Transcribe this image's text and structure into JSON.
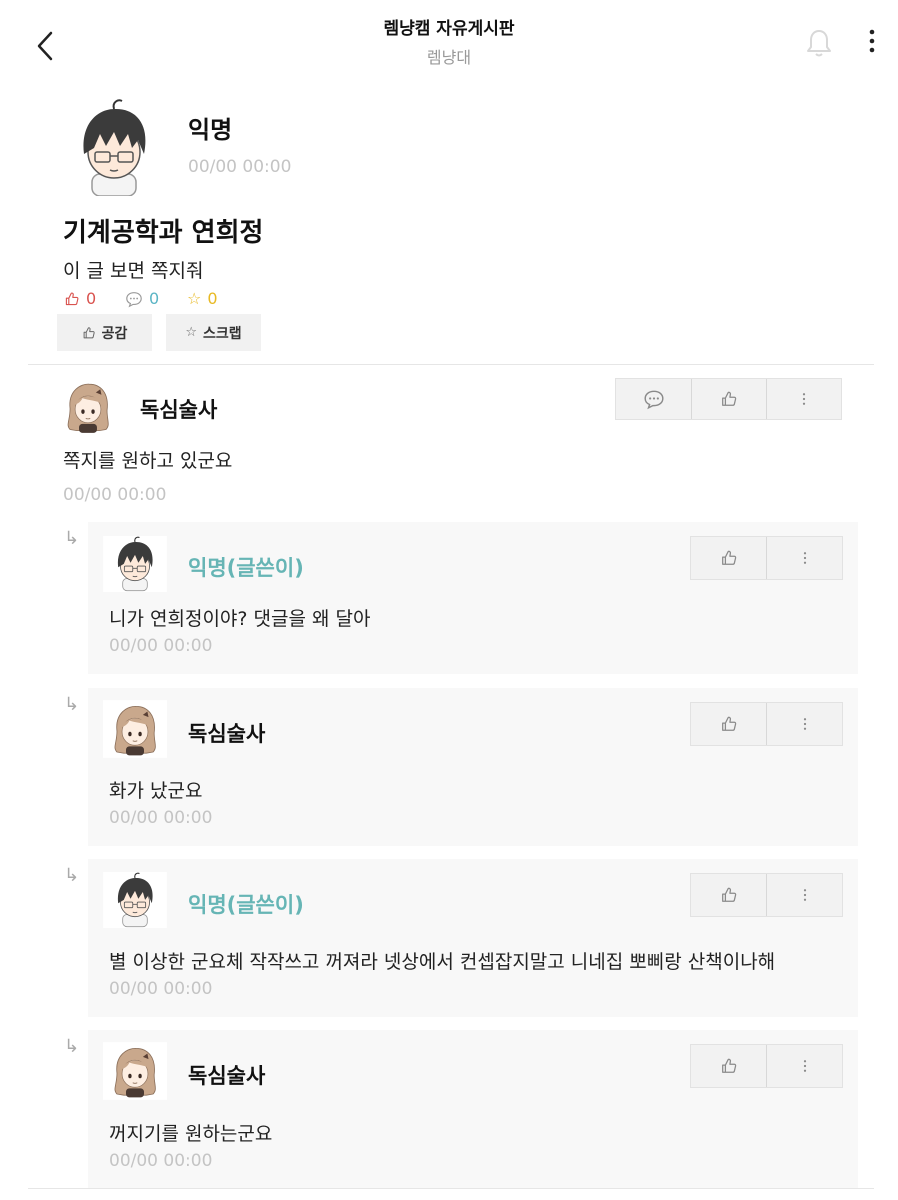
{
  "header": {
    "title": "렘냥캠 자유게시판",
    "subtitle": "렘냥대"
  },
  "post": {
    "author": "익명",
    "time": "00/00 00:00",
    "title": "기계공학과 연희정",
    "body": "이 글 보면 쪽지줘",
    "likes": "0",
    "comments": "0",
    "scraps": "0",
    "like_button": "공감",
    "scrap_button": "스크랩"
  },
  "comment": {
    "author": "독심술사",
    "body": "쪽지를 원하고 있군요",
    "time": "00/00 00:00"
  },
  "replies": [
    {
      "author": "익명(글쓴이)",
      "body": "니가 연희정이야? 댓글을 왜 달아",
      "time": "00/00 00:00"
    },
    {
      "author": "독심술사",
      "body": "화가 났군요",
      "time": "00/00 00:00"
    },
    {
      "author": "익명(글쓴이)",
      "body": "별 이상한 군요체 작작쓰고 꺼져라 넷상에서 컨셉잡지말고 니네집 뽀삐랑 산책이나해",
      "time": "00/00 00:00"
    },
    {
      "author": "독심술사",
      "body": "꺼지기를 원하는군요",
      "time": "00/00 00:00"
    }
  ],
  "colors": {
    "like_red": "#d9534f",
    "comment_teal": "#5bb5c5",
    "scrap_yellow": "#e8b923",
    "op_name_teal": "#66b5b5"
  }
}
